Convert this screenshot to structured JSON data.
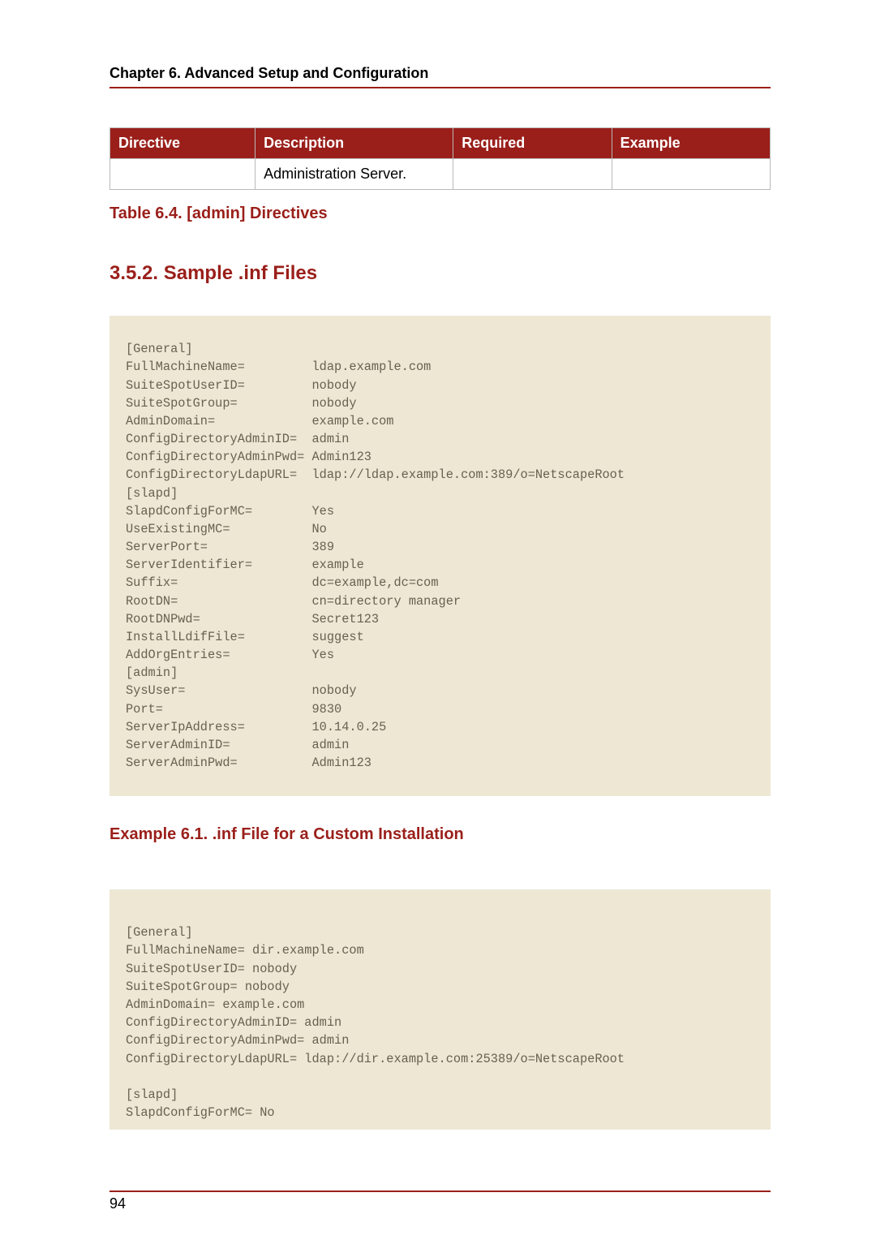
{
  "header": {
    "chapter_title": "Chapter 6. Advanced Setup and Configuration"
  },
  "table": {
    "headers": {
      "directive": "Directive",
      "description": "Description",
      "required": "Required",
      "example": "Example"
    },
    "row": {
      "directive": "",
      "description": "Administration Server.",
      "required": "",
      "example": ""
    }
  },
  "table_caption": "Table 6.4. [admin] Directives",
  "section_heading": "3.5.2. Sample .inf Files",
  "code1": "[General]\nFullMachineName=         ldap.example.com\nSuiteSpotUserID=         nobody\nSuiteSpotGroup=          nobody\nAdminDomain=             example.com\nConfigDirectoryAdminID=  admin\nConfigDirectoryAdminPwd= Admin123\nConfigDirectoryLdapURL=  ldap://ldap.example.com:389/o=NetscapeRoot\n[slapd]\nSlapdConfigForMC=        Yes\nUseExistingMC=           No\nServerPort=              389\nServerIdentifier=        example\nSuffix=                  dc=example,dc=com\nRootDN=                  cn=directory manager\nRootDNPwd=               Secret123\nInstallLdifFile=         suggest\nAddOrgEntries=           Yes\n[admin]\nSysUser=                 nobody\nPort=                    9830\nServerIpAddress=         10.14.0.25\nServerAdminID=           admin\nServerAdminPwd=          Admin123",
  "example_caption": "Example 6.1. .inf File for a Custom Installation",
  "code2": "[General]\nFullMachineName= dir.example.com\nSuiteSpotUserID= nobody\nSuiteSpotGroup= nobody\nAdminDomain= example.com\nConfigDirectoryAdminID= admin\nConfigDirectoryAdminPwd= admin\nConfigDirectoryLdapURL= ldap://dir.example.com:25389/o=NetscapeRoot\n\n[slapd]\nSlapdConfigForMC= No",
  "footer": {
    "page_number": "94"
  }
}
